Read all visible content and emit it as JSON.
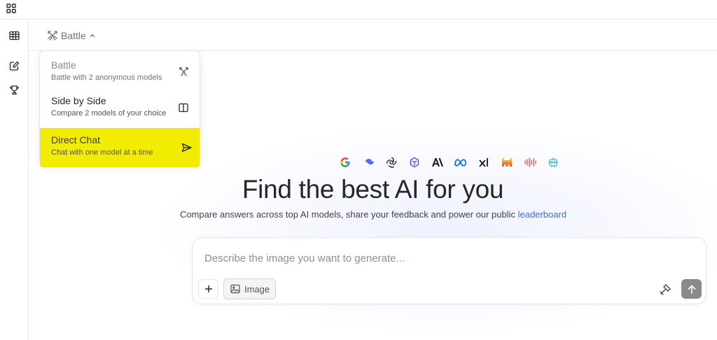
{
  "header": {
    "mode_label": "Battle"
  },
  "mode_menu": {
    "items": [
      {
        "title": "Battle",
        "subtitle": "Battle with 2 anonymous models",
        "icon": "swords-icon"
      },
      {
        "title": "Side by Side",
        "subtitle": "Compare 2 models of your choice",
        "icon": "columns-icon"
      },
      {
        "title": "Direct Chat",
        "subtitle": "Chat with one model at a time",
        "icon": "send-icon"
      }
    ]
  },
  "hero": {
    "title": "Find the best AI for you",
    "subtitle": "Compare answers across top AI models, share your feedback and power our public",
    "link_text": "leaderboard"
  },
  "provider_logos": [
    "google-logo",
    "deepseek-logo",
    "openai-logo",
    "gemini-logo",
    "anthropic-logo",
    "meta-logo",
    "xai-logo",
    "mistral-logo",
    "audio-wave-logo",
    "robot-logo"
  ],
  "composer": {
    "placeholder": "Describe the image you want to generate...",
    "image_button_label": "Image"
  },
  "colors": {
    "highlight": "#f2ec00",
    "link": "#3b6fd8",
    "send_button": "#8a8a8a"
  }
}
